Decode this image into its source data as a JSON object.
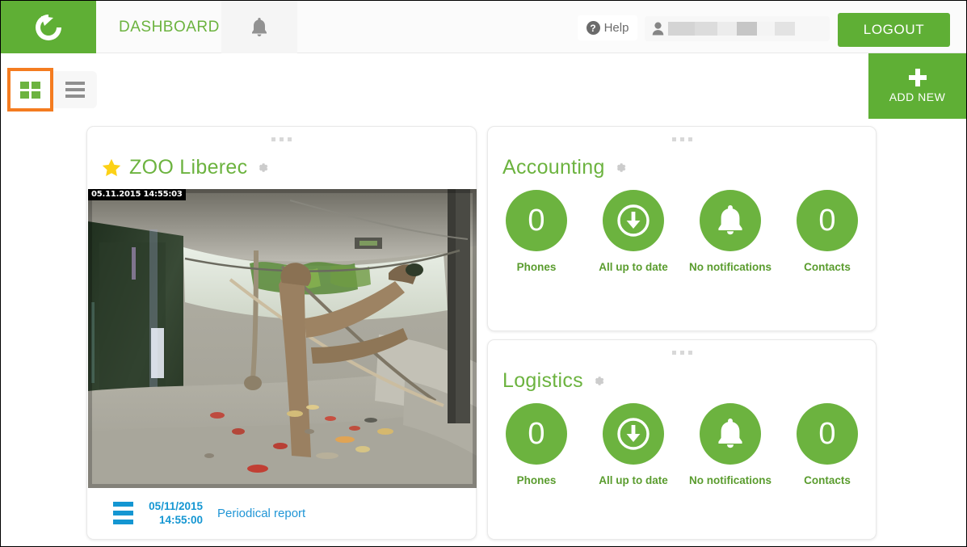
{
  "header": {
    "logo_icon": "refresh-circle-logo",
    "brand_title": "DASHBOARD",
    "notifications_icon": "bell-icon",
    "help_label": "Help",
    "help_icon": "question-mark-icon",
    "user_icon": "user-avatar-icon",
    "user_name_redacted": "",
    "logout_label": "LOGOUT",
    "accent_green": "#5faf35",
    "brand_green": "#6cb33f"
  },
  "toolbar": {
    "grid_view_icon": "grid-view-icon",
    "list_view_icon": "list-view-icon",
    "grid_view_selected": true,
    "highlight_color": "#f47c20",
    "add_new_label": "ADD NEW",
    "add_new_icon": "plus-icon"
  },
  "cards": {
    "camera": {
      "title": "ZOO Liberec",
      "favorite_icon": "star-icon",
      "settings_icon": "gear-icon",
      "drag_handle_icon": "drag-dots-icon",
      "visibility_show_icon": "eye-icon",
      "visibility_hide_icon": "eye-slash-icon",
      "visibility_active": "eye-slash-icon",
      "image_timestamp": "05.11.2015 14:55:03",
      "footer": {
        "menu_icon": "hamburger-icon",
        "report_date": "05/11/2015",
        "report_time": "14:55:00",
        "report_name": "Periodical report"
      }
    },
    "accounting": {
      "title": "Accounting",
      "settings_icon": "gear-icon",
      "drag_handle_icon": "drag-dots-icon",
      "stats": [
        {
          "icon": "number",
          "value": "0",
          "label": "Phones"
        },
        {
          "icon": "download-circle-icon",
          "value": "",
          "label": "All up to date"
        },
        {
          "icon": "bell-icon",
          "value": "",
          "label": "No notifications"
        },
        {
          "icon": "number",
          "value": "0",
          "label": "Contacts"
        }
      ]
    },
    "logistics": {
      "title": "Logistics",
      "settings_icon": "gear-icon",
      "drag_handle_icon": "drag-dots-icon",
      "stats": [
        {
          "icon": "number",
          "value": "0",
          "label": "Phones"
        },
        {
          "icon": "download-circle-icon",
          "value": "",
          "label": "All up to date"
        },
        {
          "icon": "bell-icon",
          "value": "",
          "label": "No notifications"
        },
        {
          "icon": "number",
          "value": "0",
          "label": "Contacts"
        }
      ]
    }
  }
}
